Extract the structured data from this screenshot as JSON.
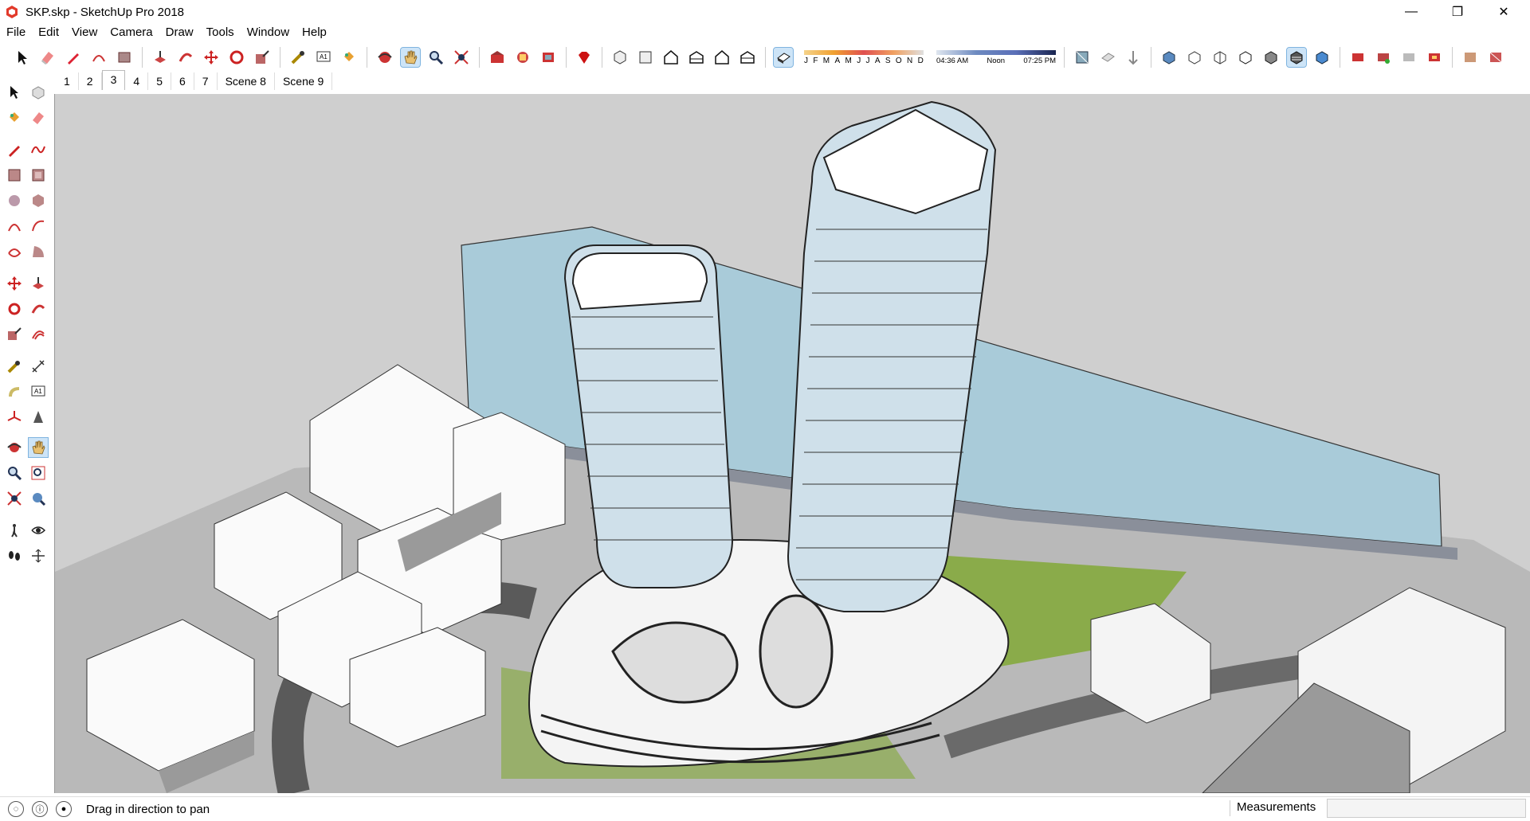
{
  "window": {
    "title": "SKP.skp - SketchUp Pro 2018",
    "minimize": "—",
    "restore": "❐",
    "close": "✕"
  },
  "menu": [
    "File",
    "Edit",
    "View",
    "Camera",
    "Draw",
    "Tools",
    "Window",
    "Help"
  ],
  "shadow": {
    "months": [
      "J",
      "F",
      "M",
      "A",
      "M",
      "J",
      "J",
      "A",
      "S",
      "O",
      "N",
      "D"
    ],
    "time_start": "04:36 AM",
    "time_mid": "Noon",
    "time_end": "07:25 PM"
  },
  "scenes": [
    "1",
    "2",
    "3",
    "4",
    "5",
    "6",
    "7",
    "Scene 8",
    "Scene 9"
  ],
  "active_scene": "3",
  "status": {
    "hint": "Drag in direction to pan",
    "measurements_label": "Measurements",
    "measurements_value": ""
  },
  "colors": {
    "accent_active": "#cde4f7",
    "water": "#a9cbd9",
    "grass": "#8aab4a",
    "ground": "#cfcfcf"
  }
}
